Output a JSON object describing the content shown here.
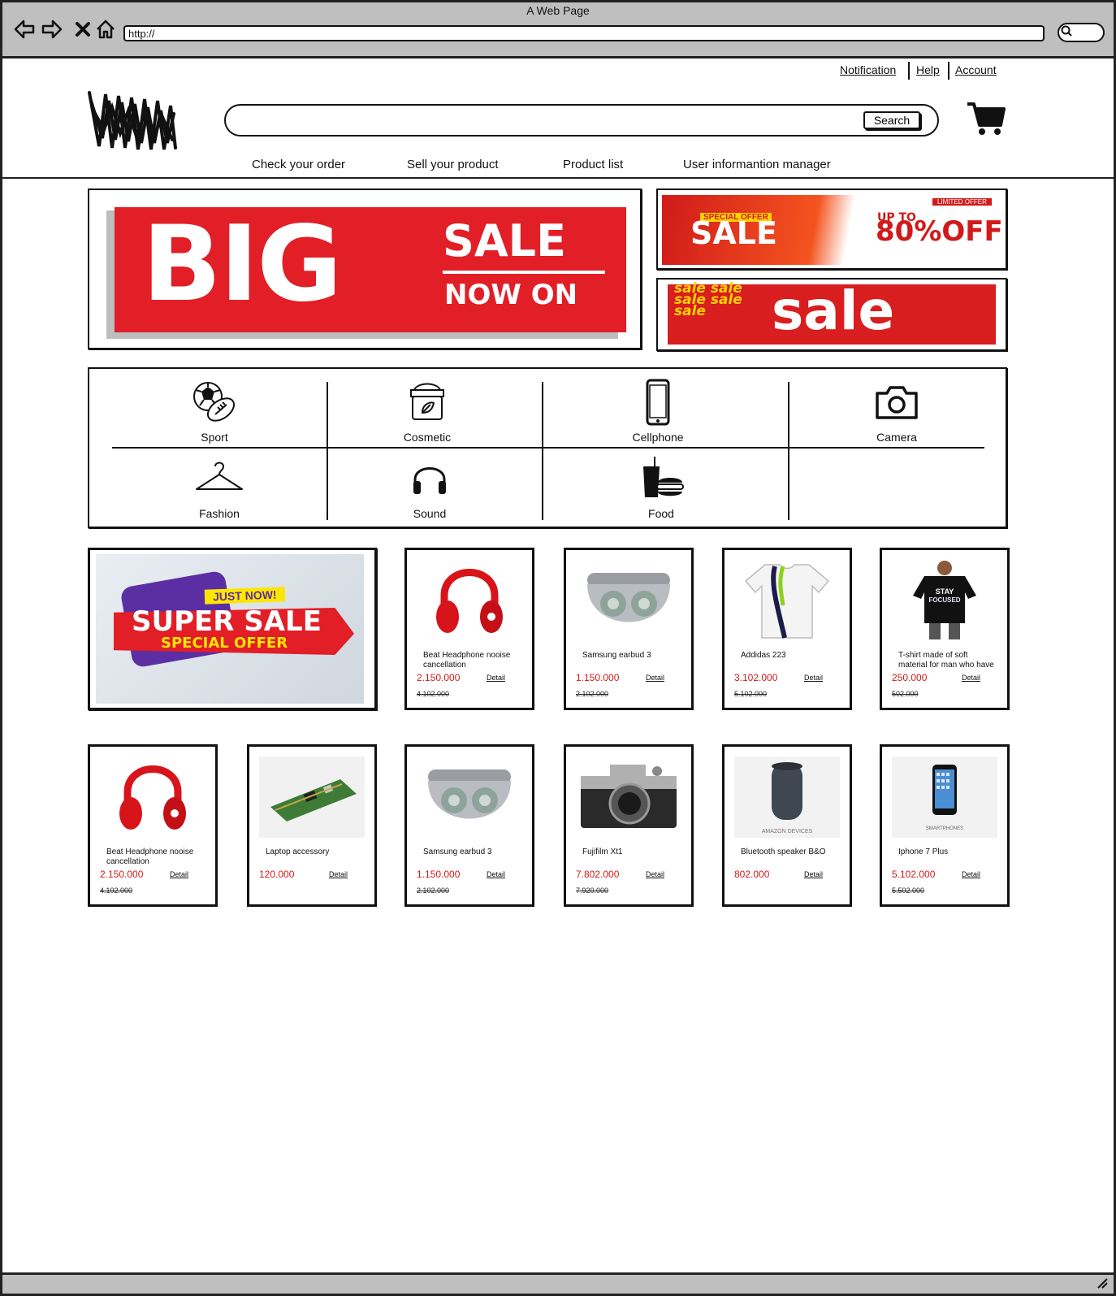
{
  "window": {
    "title": "A Web Page",
    "url": "http://"
  },
  "top_links": [
    "Notification",
    "Help",
    "Account"
  ],
  "search": {
    "button_label": "Search",
    "placeholder": ""
  },
  "nav": [
    "Check your order",
    "Sell your product",
    "Product list",
    "User informantion manager"
  ],
  "banners": {
    "big": {
      "big": "BIG",
      "sale": "SALE",
      "now_on": "NOW ON"
    },
    "right_top": {
      "special": "SPECIAL OFFER",
      "sale": "SALE",
      "up_to": "UP TO",
      "percent": "80%OFF",
      "limited": "LIMITED OFFER"
    },
    "right_bottom": {
      "small": "sale sale sale sale sale",
      "big": "sale"
    },
    "super": {
      "just_now": "JUST NOW!",
      "super_sale": "SUPER SALE",
      "special_offer": "SPECIAL OFFER"
    }
  },
  "categories": [
    {
      "label": "Sport",
      "icon": "sport-balls-icon"
    },
    {
      "label": "Cosmetic",
      "icon": "cosmetic-jar-icon"
    },
    {
      "label": "Cellphone",
      "icon": "cellphone-icon"
    },
    {
      "label": "Camera",
      "icon": "camera-icon"
    },
    {
      "label": "Fashion",
      "icon": "hanger-icon"
    },
    {
      "label": "Sound",
      "icon": "headphones-icon"
    },
    {
      "label": "Food",
      "icon": "food-icon"
    }
  ],
  "products_row1": [
    {
      "name": "Beat Headphone nooise cancellation",
      "price": "2.150.000",
      "old_price": "4.102.000",
      "detail": "Detail",
      "image": "red-headphone"
    },
    {
      "name": "Samsung earbud 3",
      "price": "1.150.000",
      "old_price": "2.102.000",
      "detail": "Detail",
      "image": "earbuds"
    },
    {
      "name": "Addidas 223",
      "price": "3.102.000",
      "old_price": "5.102.000",
      "detail": "Detail",
      "image": "white-shirt"
    },
    {
      "name": "T-shirt made of soft material for man who have",
      "price": "250.000",
      "old_price": "502.000",
      "detail": "Detail",
      "image": "black-tshirt"
    }
  ],
  "products_row2": [
    {
      "name": "Beat Headphone nooise cancellation",
      "price": "2.150.000",
      "old_price": "4.102.000",
      "detail": "Detail",
      "image": "red-headphone"
    },
    {
      "name": "Laptop accessory",
      "price": "120.000",
      "old_price": "",
      "detail": "Detail",
      "image": "circuit-board"
    },
    {
      "name": "Samsung earbud 3",
      "price": "1.150.000",
      "old_price": "2.102.000",
      "detail": "Detail",
      "image": "earbuds"
    },
    {
      "name": "Fujifilm Xt1",
      "price": "7.802.000",
      "old_price": "7.920.000",
      "detail": "Detail",
      "image": "camera"
    },
    {
      "name": "Bluetooth speaker B&O",
      "price": "802.000",
      "old_price": "",
      "detail": "Detail",
      "image": "speaker"
    },
    {
      "name": "Iphone 7 Plus",
      "price": "5.102.000",
      "old_price": "5.502.000",
      "detail": "Detail",
      "image": "iphone"
    }
  ]
}
